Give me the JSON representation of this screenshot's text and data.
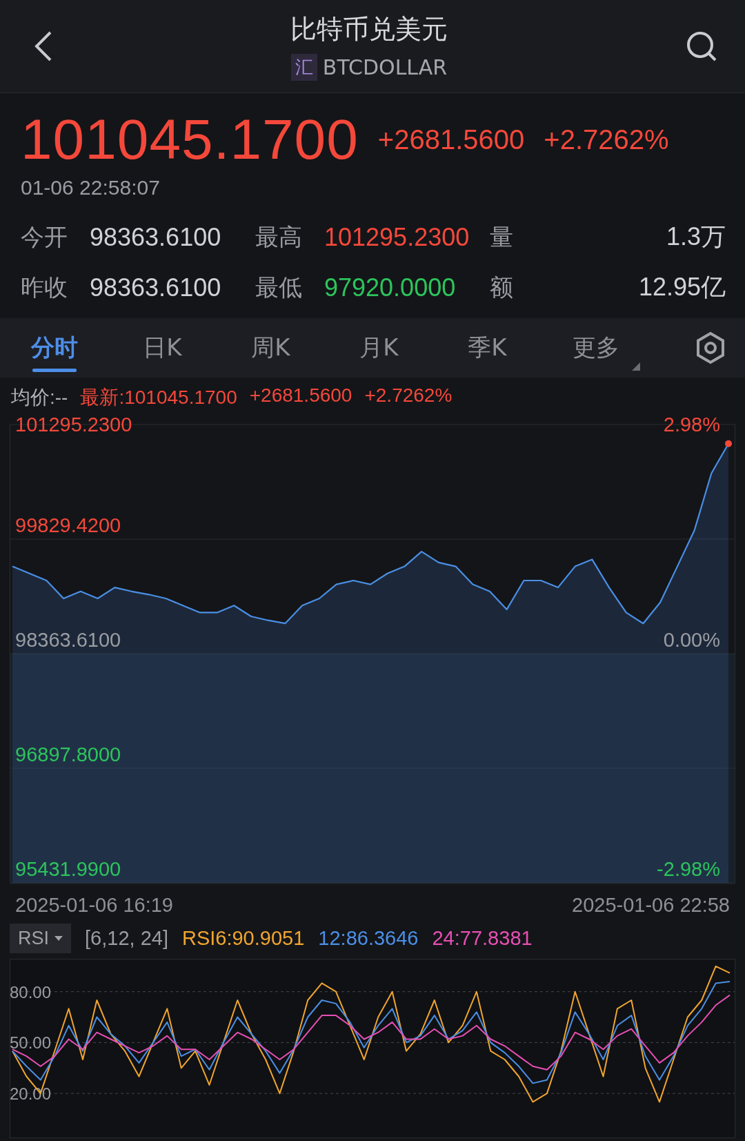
{
  "header": {
    "title": "比特币兑美元",
    "badge": "汇",
    "symbol": "BTCDOLLAR"
  },
  "quote": {
    "price": "101045.1700",
    "change": "+2681.5600",
    "change_pct": "+2.7262%",
    "color": "#f4483b",
    "time": "01-06 22:58:07"
  },
  "stats": [
    {
      "label": "今开",
      "value": "98363.6100",
      "color": "#d0d2d8"
    },
    {
      "label": "最高",
      "value": "101295.2300",
      "color": "#f4483b"
    },
    {
      "label": "量",
      "value": "1.3万",
      "color": "#d0d2d8"
    },
    {
      "label": "昨收",
      "value": "98363.6100",
      "color": "#d0d2d8"
    },
    {
      "label": "最低",
      "value": "97920.0000",
      "color": "#2cc45c"
    },
    {
      "label": "额",
      "value": "12.95亿",
      "color": "#d0d2d8"
    }
  ],
  "tabs": [
    {
      "label": "分时",
      "kind": "period",
      "selected": true
    },
    {
      "label": "日K",
      "kind": "period",
      "selected": false
    },
    {
      "label": "周K",
      "kind": "period",
      "selected": false
    },
    {
      "label": "月K",
      "kind": "period",
      "selected": false
    },
    {
      "label": "季K",
      "kind": "period",
      "selected": false
    },
    {
      "label": "更多",
      "kind": "menu",
      "selected": false
    }
  ],
  "info_line": [
    {
      "text": "均价:--",
      "color": "#b0b2b8"
    },
    {
      "text": "最新:101045.1700",
      "color": "#f4483b"
    },
    {
      "text": "+2681.5600",
      "color": "#f4483b"
    },
    {
      "text": "+2.7262%",
      "color": "#f4483b"
    }
  ],
  "price_chart": {
    "right_labels": [
      {
        "text": "2.98%",
        "color": "#f4483b"
      },
      {
        "text": "0.00%",
        "color": "#9a9ca3"
      },
      {
        "text": "-2.98%",
        "color": "#2cc45c"
      }
    ],
    "time_start": "2025-01-06 16:19",
    "time_end": "2025-01-06 22:58",
    "chart_data": {
      "type": "area",
      "grid": true,
      "series": [
        {
          "color": "#4a8fe6",
          "values": [
            99480,
            99390,
            99300,
            99070,
            99160,
            99070,
            99210,
            99160,
            99120,
            99070,
            98980,
            98890,
            98890,
            98980,
            98840,
            98790,
            98750,
            98980,
            99070,
            99250,
            99300,
            99250,
            99390,
            99480,
            99670,
            99530,
            99480,
            99250,
            99160,
            98930,
            99300,
            99300,
            99210,
            99480,
            99570,
            99210,
            98890,
            98750,
            99020,
            99480,
            99940,
            100670,
            101050
          ]
        }
      ],
      "ylim": [
        95431.99,
        101295.23
      ],
      "yticks": [
        {
          "value": 101295.23,
          "label": "101295.2300"
        },
        {
          "value": 99829.42,
          "label": "99829.4200"
        },
        {
          "value": 98363.61,
          "label": "98363.6100"
        },
        {
          "value": 96897.8,
          "label": "96897.8000"
        },
        {
          "value": 95431.99,
          "label": "95431.9900"
        }
      ]
    }
  },
  "rsi": {
    "selector": "RSI",
    "params": "[6,12, 24]",
    "legend": [
      {
        "value": ":90.9051"
      },
      {
        "value": ":86.3646"
      },
      {
        "value": ":77.8381"
      }
    ],
    "chart_data": {
      "type": "line",
      "grid": true,
      "series": [
        {
          "name": "RSI6",
          "color": "#f0a530",
          "values": [
            45,
            30,
            20,
            45,
            70,
            40,
            75,
            55,
            45,
            30,
            50,
            70,
            35,
            45,
            25,
            50,
            75,
            55,
            40,
            20,
            45,
            75,
            85,
            80,
            60,
            40,
            65,
            80,
            45,
            55,
            75,
            50,
            60,
            80,
            45,
            40,
            30,
            15,
            20,
            45,
            80,
            55,
            30,
            70,
            75,
            35,
            15,
            40,
            65,
            75,
            95,
            91
          ]
        },
        {
          "name": "12",
          "color": "#4a8fe6",
          "values": [
            45,
            36,
            28,
            42,
            60,
            45,
            65,
            55,
            48,
            38,
            50,
            62,
            42,
            46,
            34,
            50,
            65,
            55,
            45,
            32,
            46,
            65,
            75,
            73,
            62,
            47,
            60,
            70,
            50,
            54,
            66,
            52,
            57,
            68,
            50,
            44,
            36,
            26,
            28,
            44,
            68,
            55,
            40,
            60,
            66,
            42,
            28,
            42,
            60,
            70,
            85,
            86
          ]
        },
        {
          "name": "24",
          "color": "#e64fb4",
          "values": [
            46,
            42,
            36,
            42,
            52,
            46,
            56,
            52,
            48,
            44,
            48,
            54,
            46,
            46,
            40,
            48,
            56,
            52,
            46,
            40,
            46,
            56,
            66,
            66,
            60,
            52,
            56,
            62,
            52,
            52,
            58,
            52,
            54,
            60,
            52,
            48,
            42,
            36,
            34,
            42,
            56,
            52,
            46,
            54,
            58,
            48,
            38,
            44,
            54,
            62,
            72,
            78
          ]
        }
      ],
      "ylim": [
        -6,
        99
      ],
      "yticks": [
        {
          "value": 80,
          "label": "80.00"
        },
        {
          "value": 50,
          "label": "50.00"
        },
        {
          "value": 20,
          "label": "20.00"
        }
      ]
    }
  }
}
